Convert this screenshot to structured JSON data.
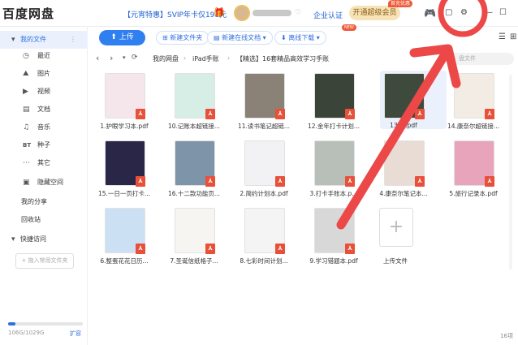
{
  "app": {
    "title": "百度网盘"
  },
  "header": {
    "promo": "【元宵特惠】SVIP年卡仅198元",
    "vip_badge": "♡",
    "enterprise": "企业认证",
    "vip_button": "开通超级会员",
    "hot_tag": "首充优惠",
    "icons": [
      "gift-icon",
      "game-icon",
      "mail-icon",
      "settings-icon",
      "minimize-icon",
      "maximize-icon",
      "close-icon"
    ]
  },
  "sidebar": {
    "my_files": "我的文件",
    "items": [
      {
        "label": "最近",
        "icon": "clock-icon"
      },
      {
        "label": "图片",
        "icon": "image-icon"
      },
      {
        "label": "视频",
        "icon": "video-icon"
      },
      {
        "label": "文档",
        "icon": "doc-icon"
      },
      {
        "label": "音乐",
        "icon": "music-icon"
      },
      {
        "label": "种子",
        "icon": "bt-icon"
      },
      {
        "label": "其它",
        "icon": "other-icon"
      },
      {
        "label": "隐藏空间",
        "icon": "lock-icon"
      }
    ],
    "my_share": "我的分享",
    "recycle": "回收站",
    "quick_access": "快捷访问",
    "add_quick": "+ 拖入常用文件夹",
    "quota": "106G/1029G",
    "quota_fraction": 0.103,
    "expand": "扩容"
  },
  "toolbar": {
    "upload": "上传",
    "new_folder": "新建文件夹",
    "new_online_doc": "新建在线文档",
    "new_tag": "NEW",
    "offline_download": "离线下载"
  },
  "nav": {
    "crumbs": [
      "我的网盘",
      "iPad手账",
      "【精选】16套精品高效学习手账"
    ],
    "search_placeholder": "盘文件"
  },
  "files": [
    {
      "name": "1.护眼学习本.pdf",
      "color": "#f4e6ea"
    },
    {
      "name": "10.记账本超链接...",
      "color": "#d6eee6"
    },
    {
      "name": "11.读书笔记超链...",
      "color": "#8a8276"
    },
    {
      "name": "12.金年打卡计划...",
      "color": "#3a4438"
    },
    {
      "name": "13.....pdf",
      "color": "#3e4a3c"
    },
    {
      "name": "14.康奈尔超链接...",
      "color": "#f3ece4"
    },
    {
      "name": "15.一日一页打卡...",
      "color": "#2a2648"
    },
    {
      "name": "16.十二款功能页...",
      "color": "#7e94a8"
    },
    {
      "name": "2.简约计划本.pdf",
      "color": "#f2f2f4"
    },
    {
      "name": "3.打卡手账本.p...",
      "color": "#b8bfb8"
    },
    {
      "name": "4.康奈尔笔记本...",
      "color": "#e8dcd4"
    },
    {
      "name": "5.旅行记录本.pdf",
      "color": "#e8a4ba"
    },
    {
      "name": "6.整蛋花花日历...",
      "color": "#cce0f4"
    },
    {
      "name": "7.圣诞信纸格子...",
      "color": "#f7f5f2"
    },
    {
      "name": "8.七彩时间计划...",
      "color": "#f4f4f4"
    },
    {
      "name": "9.学习错题本.pdf",
      "color": "#d8d8d8"
    }
  ],
  "upload_tile": "上传文件",
  "count": "16项",
  "annotation": {
    "color": "#ec4848"
  }
}
